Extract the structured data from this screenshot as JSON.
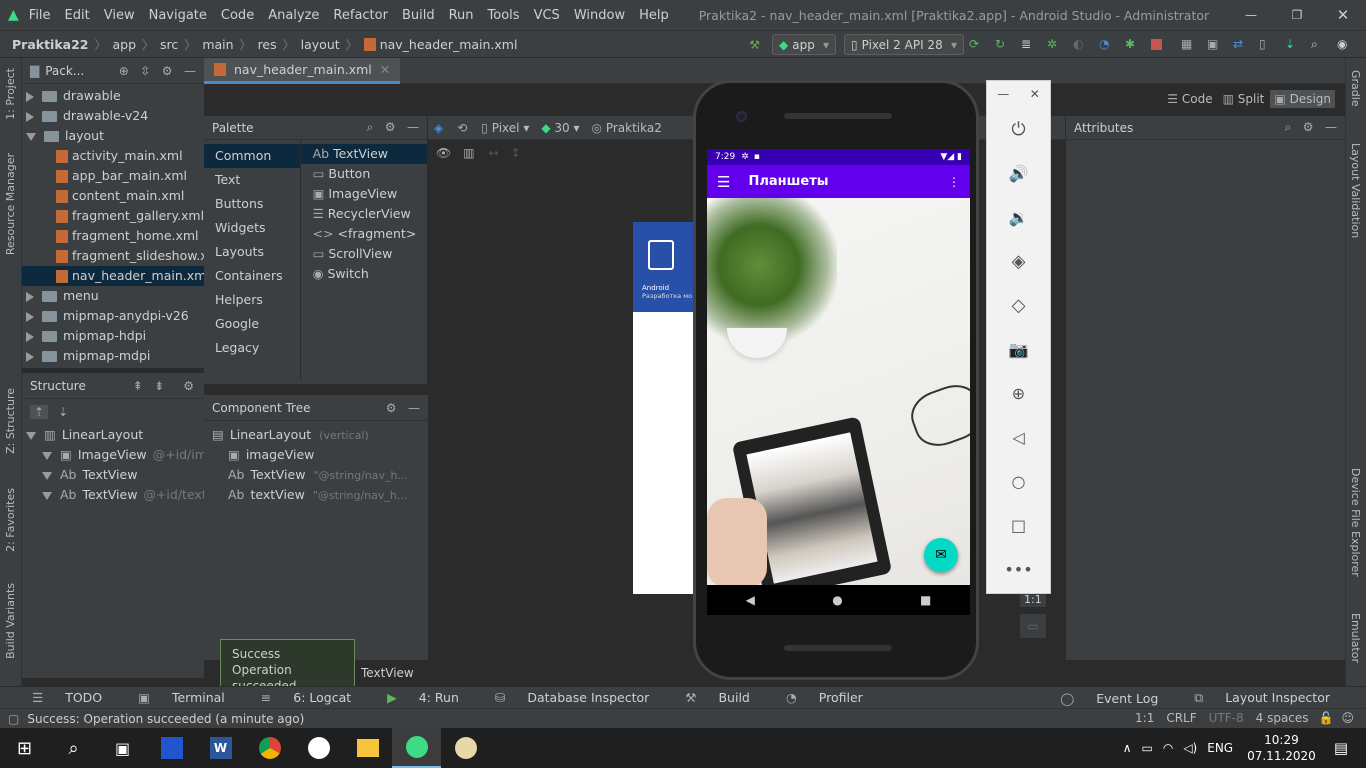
{
  "window": {
    "title": "Praktika2 - nav_header_main.xml [Praktika2.app] - Android Studio - Administrator"
  },
  "menu": [
    "File",
    "Edit",
    "View",
    "Navigate",
    "Code",
    "Analyze",
    "Refactor",
    "Build",
    "Run",
    "Tools",
    "VCS",
    "Window",
    "Help"
  ],
  "breadcrumb": [
    "Praktika22",
    "app",
    "src",
    "main",
    "res",
    "layout",
    "nav_header_main.xml"
  ],
  "run_config": "app",
  "device": "Pixel 2 API 28",
  "project": {
    "header": "Pack...",
    "items": [
      {
        "label": "drawable",
        "type": "folder",
        "open": false,
        "depth": 0
      },
      {
        "label": "drawable-v24",
        "type": "folder",
        "open": false,
        "depth": 0
      },
      {
        "label": "layout",
        "type": "folder",
        "open": true,
        "depth": 0
      },
      {
        "label": "activity_main.xml",
        "type": "xml",
        "depth": 1
      },
      {
        "label": "app_bar_main.xml",
        "type": "xml",
        "depth": 1
      },
      {
        "label": "content_main.xml",
        "type": "xml",
        "depth": 1
      },
      {
        "label": "fragment_gallery.xml",
        "type": "xml",
        "depth": 1
      },
      {
        "label": "fragment_home.xml",
        "type": "xml",
        "depth": 1
      },
      {
        "label": "fragment_slideshow.xm",
        "type": "xml",
        "depth": 1
      },
      {
        "label": "nav_header_main.xml",
        "type": "xml",
        "depth": 1,
        "selected": true
      },
      {
        "label": "menu",
        "type": "folder",
        "open": false,
        "depth": 0
      },
      {
        "label": "mipmap-anydpi-v26",
        "type": "folder",
        "open": false,
        "depth": 0
      },
      {
        "label": "mipmap-hdpi",
        "type": "folder",
        "open": false,
        "depth": 0
      },
      {
        "label": "mipmap-mdpi",
        "type": "folder",
        "open": false,
        "depth": 0
      }
    ]
  },
  "structure": {
    "header": "Structure",
    "items": [
      {
        "label": "LinearLayout",
        "hint": ""
      },
      {
        "label": "ImageView",
        "hint": "@+id/imag"
      },
      {
        "label": "TextView",
        "hint": ""
      },
      {
        "label": "TextView",
        "hint": "@+id/textVie"
      }
    ]
  },
  "editor_tab": "nav_header_main.xml",
  "view_modes": [
    "Code",
    "Split",
    "Design"
  ],
  "design_toolbar": {
    "device": "Pixel",
    "api": "30",
    "theme": "Praktika2"
  },
  "palette": {
    "header": "Palette",
    "categories": [
      "Common",
      "Text",
      "Buttons",
      "Widgets",
      "Layouts",
      "Containers",
      "Helpers",
      "Google",
      "Legacy"
    ],
    "items": [
      "TextView",
      "Button",
      "ImageView",
      "RecyclerView",
      "<fragment>",
      "ScrollView",
      "Switch"
    ],
    "item_icons": [
      "Ab",
      "▭",
      "▣",
      "☰",
      "<>",
      "▭",
      "◉"
    ]
  },
  "component_tree": {
    "header": "Component Tree",
    "items": [
      {
        "label": "LinearLayout",
        "hint": "(vertical)",
        "icon": "▤"
      },
      {
        "label": "imageView",
        "hint": "",
        "icon": "▣"
      },
      {
        "label": "TextView",
        "hint": "\"@string/nav_h...",
        "icon": "Ab"
      },
      {
        "label": "textView",
        "hint": "\"@string/nav_h...",
        "icon": "Ab"
      }
    ]
  },
  "attributes": {
    "header": "Attributes"
  },
  "preview": {
    "title": "Android",
    "subtitle": "Разработка мо"
  },
  "canvas": {
    "zoom_label": "1:1",
    "bottom_label": "TextView"
  },
  "emulator": {
    "time": "7:29",
    "appbar_title": "Планшеты"
  },
  "toast": {
    "title": "Success",
    "message": "Operation succeeded"
  },
  "left_tool_windows": [
    "1: Project",
    "Resource Manager",
    "Z: Structure",
    "2: Favorites",
    "Build Variants"
  ],
  "right_tool_windows": [
    "Gradle",
    "Layout Validation",
    "Device File Explorer",
    "Emulator"
  ],
  "bottom_tools": [
    "TODO",
    "Terminal",
    "6: Logcat",
    "4: Run",
    "Database Inspector",
    "Build",
    "Profiler"
  ],
  "bottom_tools_right": [
    "Event Log",
    "Layout Inspector"
  ],
  "status": {
    "message": "Success: Operation succeeded (a minute ago)",
    "position": "1:1",
    "line_sep": "CRLF",
    "encoding": "UTF-8",
    "indent": "4 spaces"
  },
  "taskbar": {
    "time": "10:29",
    "date": "07.11.2020",
    "lang": "ENG"
  }
}
